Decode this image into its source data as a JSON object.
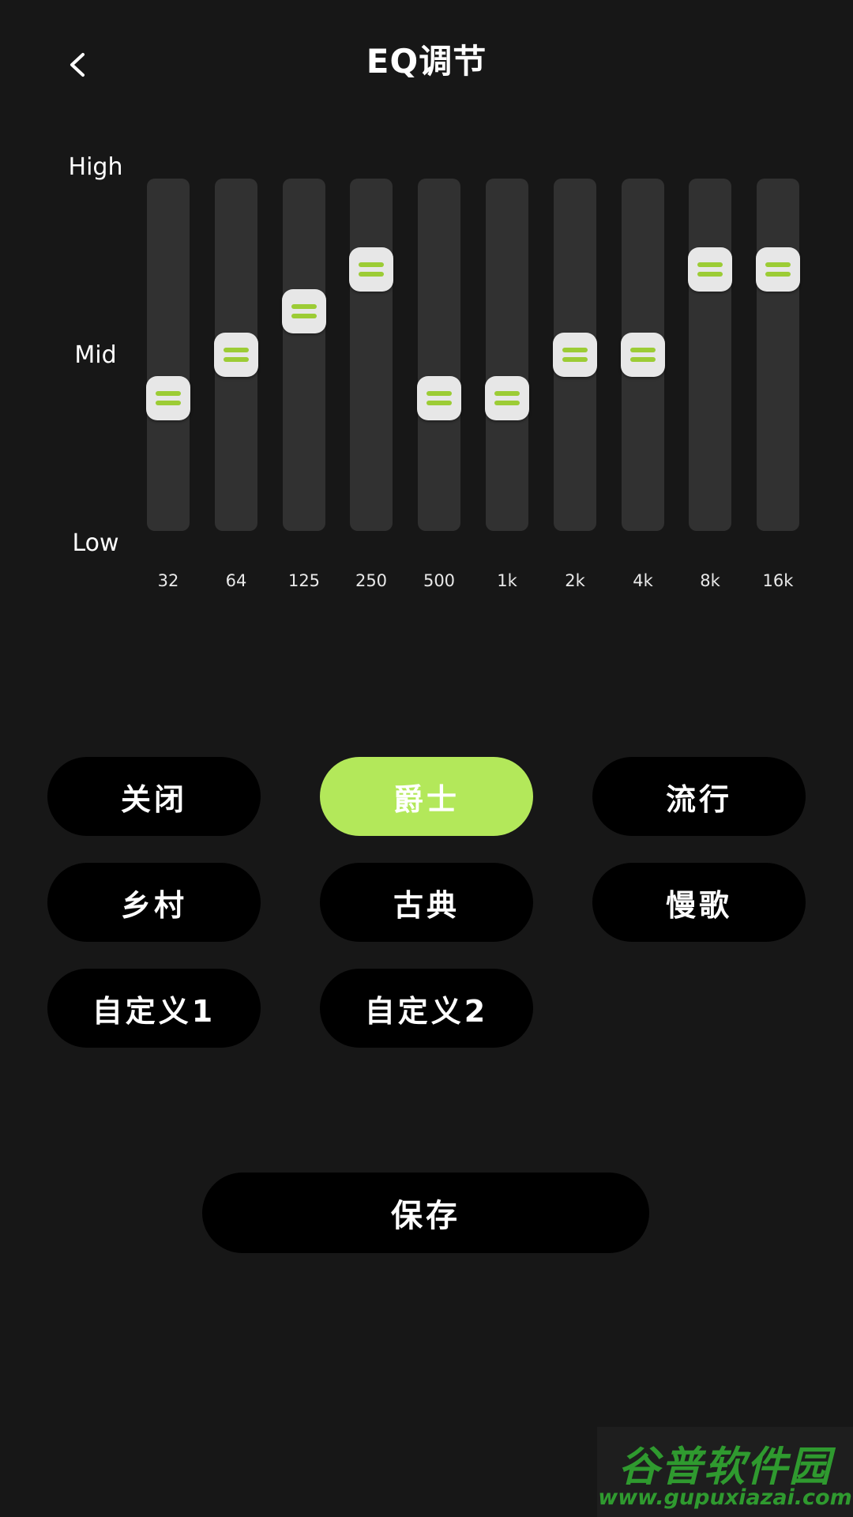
{
  "header": {
    "title": "EQ调节",
    "back_icon": "chevron-left-icon"
  },
  "eq": {
    "level_labels": {
      "high": "High",
      "mid": "Mid",
      "low": "Low"
    },
    "accent_color": "#9ccc35",
    "bands": [
      {
        "freq": "32",
        "level": 0.33
      },
      {
        "freq": "64",
        "level": 0.5
      },
      {
        "freq": "125",
        "level": 0.67
      },
      {
        "freq": "250",
        "level": 0.83
      },
      {
        "freq": "500",
        "level": 0.33
      },
      {
        "freq": "1k",
        "level": 0.33
      },
      {
        "freq": "2k",
        "level": 0.5
      },
      {
        "freq": "4k",
        "level": 0.5
      },
      {
        "freq": "8k",
        "level": 0.83
      },
      {
        "freq": "16k",
        "level": 0.83
      }
    ]
  },
  "presets": {
    "active_color": "#b3e85a",
    "items": [
      {
        "label": "关闭",
        "active": false
      },
      {
        "label": "爵士",
        "active": true
      },
      {
        "label": "流行",
        "active": false
      },
      {
        "label": "乡村",
        "active": false
      },
      {
        "label": "古典",
        "active": false
      },
      {
        "label": "慢歌",
        "active": false
      },
      {
        "label": "自定义1",
        "active": false
      },
      {
        "label": "自定义2",
        "active": false
      }
    ]
  },
  "save_label": "保存",
  "watermark": {
    "logo": "谷普软件园",
    "url": "www.gupuxiazai.com"
  }
}
